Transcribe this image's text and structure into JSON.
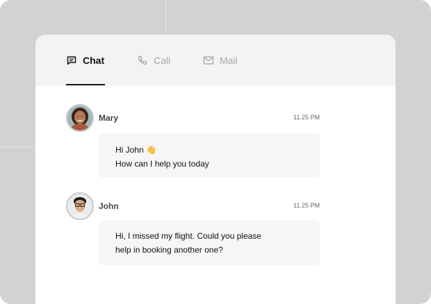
{
  "tabs": {
    "chat": "Chat",
    "call": "Call",
    "mail": "Mail"
  },
  "messages": [
    {
      "sender": "Mary",
      "time": "11.25 PM",
      "lines": [
        "Hi John 👋",
        "How can I help you today"
      ]
    },
    {
      "sender": "John",
      "time": "11.25 PM",
      "lines": [
        "Hi, I missed my flight. Could you please",
        "help in booking another one?"
      ]
    }
  ],
  "colors": {
    "backdrop": "#d2d2d2",
    "tab_active": "#111111",
    "tab_inactive": "#a9a9a9",
    "bubble": "#f6f6f6"
  }
}
